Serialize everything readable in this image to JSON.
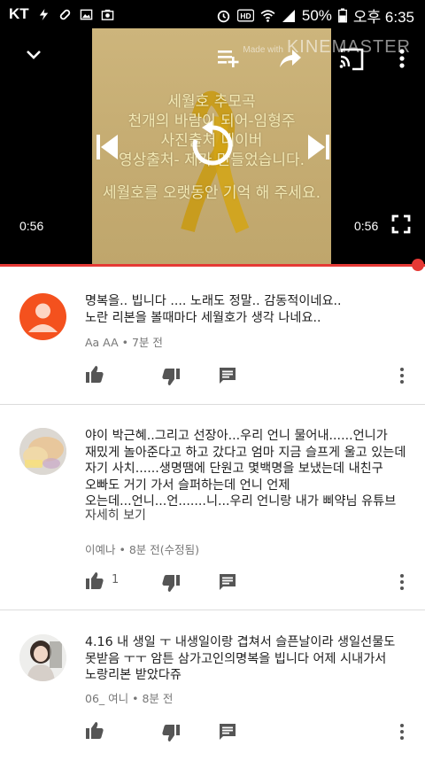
{
  "status_bar": {
    "carrier": "KT",
    "battery": "50%",
    "time": "오후 6:35",
    "icons": [
      "flash-icon",
      "pill-icon",
      "image-icon",
      "camera-icon",
      "alarm-icon",
      "hd-icon",
      "wifi-icon",
      "signal-icon",
      "battery-icon"
    ]
  },
  "player": {
    "watermark_prefix": "Made with",
    "watermark": "KINEMASTER",
    "overlay_lines": [
      "세월호 추모곡",
      "천개의 바람이 되어-임형주",
      "사진출처 네이버",
      "영상출처- 제가 만들었습니다.",
      "세월호를 오랫동안 기억 해 주세요."
    ],
    "time_current": "0:56",
    "time_total": "0:56",
    "progress": 1.0,
    "accent_color": "#e53935",
    "icons": [
      "chevron-down-icon",
      "add-to-queue-icon",
      "share-icon",
      "cast-icon",
      "more-vert-icon",
      "previous-icon",
      "replay-icon",
      "next-icon",
      "fullscreen-icon"
    ]
  },
  "comments": [
    {
      "avatar": "default-person-avatar",
      "lines": [
        "명복을.. 빕니다 .... 노래도 정말.. 감동적이네요..",
        "노란 리본을 볼때마다 세월호가 생각 나네요.."
      ],
      "author": "Aa AA",
      "time": "7분 전",
      "likes": ""
    },
    {
      "avatar": "photo-avatar",
      "lines": [
        "야이 박근혜..그리고 선장아...우리 언니 물어내......언니가",
        "재밌게 놀아준다고 하고 갔다고 엄마 지금 슬프게 울고 있는데",
        "자기 사치......생명땜에 단원고 몇백명을 보냈는데 내친구",
        "오빠도 거기 가서 슬퍼하는데 언니 언제",
        "오는데...언니...언.......니...우리 언니랑 내가 삐약님 유튜브"
      ],
      "read_more": "자세히 보기",
      "author": "이예나",
      "time": "8분 전(수정됨)",
      "likes": "1"
    },
    {
      "avatar": "photo-avatar",
      "lines": [
        "4.16 내 생일 ㅜ 내생일이랑 겹쳐서 슬픈날이라 생일선물도",
        "못받음 ㅜㅜ 암튼 삼가고인의명복을 빕니다 어제 시내가서",
        "노랑리본 받았다쥬"
      ],
      "author": "06_ 여니",
      "time": "8분 전",
      "likes": ""
    }
  ],
  "meta_separator": " • ",
  "icons": [
    "thumb-up-icon",
    "thumb-down-icon",
    "reply-icon",
    "more-vert-icon"
  ]
}
